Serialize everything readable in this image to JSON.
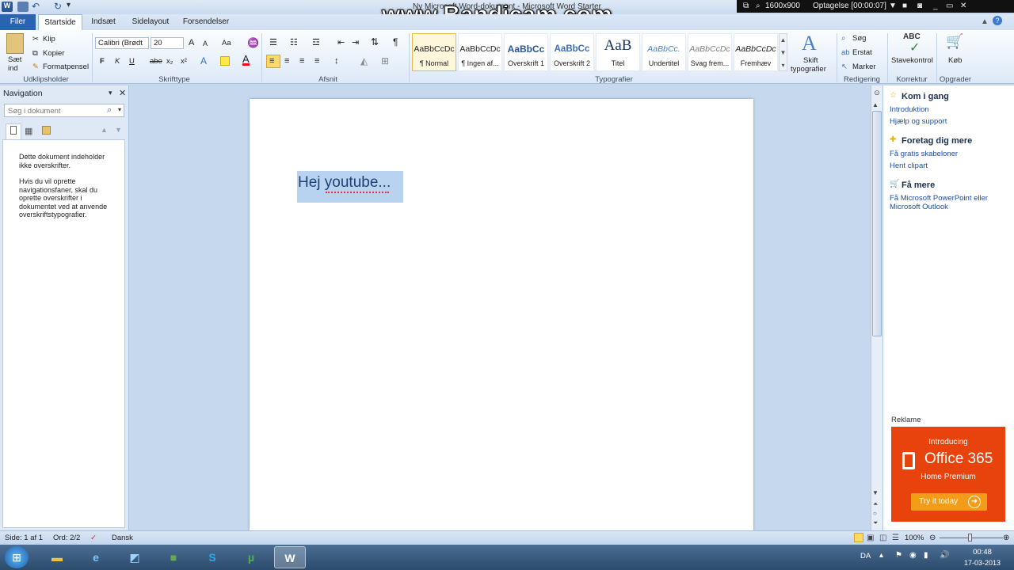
{
  "window": {
    "title": "Ny Microsoft Word-dokument - Microsoft Word Starter",
    "watermark": "www.Bandicam.com"
  },
  "recorder": {
    "resolution": "1600x900",
    "recording": "Optagelse [00:00:07]"
  },
  "tabs": [
    "Filer",
    "Startside",
    "Indsæt",
    "Sidelayout",
    "Forsendelser"
  ],
  "clipboard": {
    "paste_label_1": "Sæt",
    "paste_label_2": "ind",
    "cut": "Klip",
    "copy": "Kopier",
    "format_painter": "Formatpensel",
    "group_label": "Udklipsholder"
  },
  "font": {
    "font_name": "Calibri (Brødt",
    "font_size": "20",
    "bold": "F",
    "italic": "K",
    "underline": "U",
    "strike": "abe",
    "subscript": "x₂",
    "superscript": "x²",
    "grow": "A",
    "shrink": "A",
    "change_case": "Aa",
    "group_label": "Skrifttype"
  },
  "paragraph": {
    "group_label": "Afsnit",
    "pilcrow": "¶"
  },
  "styles": {
    "group_label": "Typografier",
    "items": [
      {
        "preview": "AaBbCcDc",
        "name": "¶ Normal"
      },
      {
        "preview": "AaBbCcDc",
        "name": "¶ Ingen af..."
      },
      {
        "preview": "AaBbCc",
        "name": "Overskrift 1"
      },
      {
        "preview": "AaBbCc",
        "name": "Overskrift 2"
      },
      {
        "preview": "AaB",
        "name": "Titel"
      },
      {
        "preview": "AaBbCc.",
        "name": "Undertitel"
      },
      {
        "preview": "AaBbCcDc",
        "name": "Svag frem..."
      },
      {
        "preview": "AaBbCcDc",
        "name": "Fremhæv"
      }
    ],
    "change_styles_1": "Skift",
    "change_styles_2": "typografier"
  },
  "editing": {
    "find": "Søg",
    "replace": "Erstat",
    "select": "Marker",
    "group_label": "Redigering"
  },
  "proofing": {
    "spelling": "Stavekontrol",
    "group_label": "Korrektur"
  },
  "upgrade": {
    "buy": "Køb",
    "group_label": "Opgrader"
  },
  "navigation": {
    "title": "Navigation",
    "search_placeholder": "Søg i dokument",
    "message_1": "Dette dokument indeholder ikke overskrifter.",
    "message_2": "Hvis du vil oprette navigationsfaner, skal du oprette overskrifter i dokumentet ved at anvende overskriftstypografier."
  },
  "document": {
    "text": "Hej youtube..."
  },
  "right_pane": {
    "sections": [
      {
        "title": "Kom i gang",
        "links": [
          "Introduktion",
          "Hjælp og support"
        ]
      },
      {
        "title": "Foretag dig mere",
        "links": [
          "Få gratis skabeloner",
          "Hent clipart"
        ]
      },
      {
        "title": "Få mere",
        "links": [
          "Få Microsoft PowerPoint eller Microsoft Outlook"
        ]
      }
    ],
    "ad_label": "Reklame",
    "ad": {
      "intro": "Introducing",
      "product": "Office 365",
      "edition": "Home Premium",
      "cta": "Try it today"
    }
  },
  "status": {
    "page": "Side: 1 af 1",
    "words": "Ord: 2/2",
    "language": "Dansk",
    "zoom": "100%"
  },
  "taskbar": {
    "lang": "DA",
    "time": "00:48",
    "date": "17-03-2013"
  },
  "colors": {
    "accent": "#2a62b4",
    "selection": "#b8d3ef",
    "ad": "#e8420d"
  }
}
